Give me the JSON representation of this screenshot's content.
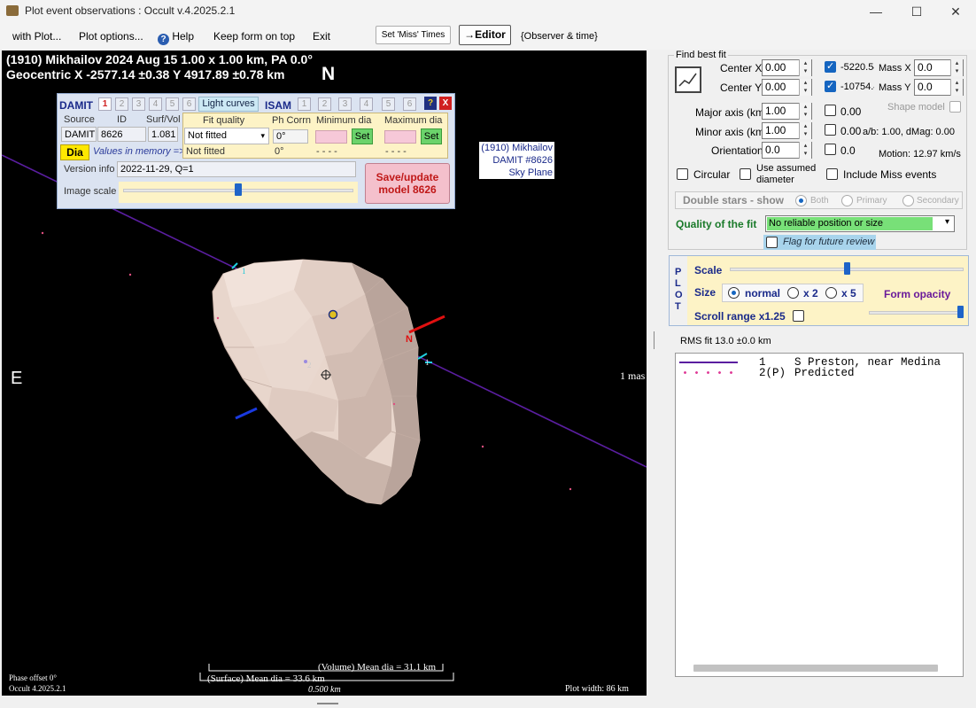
{
  "window": {
    "title": "Plot event observations : Occult v.4.2025.2.1",
    "icons": {
      "app": "app-icon",
      "minimize": "minimize-icon",
      "maximize": "maximize-icon",
      "close": "close-icon"
    }
  },
  "menu": {
    "with_plot": "with Plot...",
    "plot_options": "Plot options...",
    "help": "Help",
    "keep_on_top": "Keep form on top",
    "exit": "Exit",
    "miss_times": "Set 'Miss' Times",
    "editor": "→Editor",
    "observer_time": "{Observer & time}"
  },
  "plot": {
    "header_line1": "(1910) Mikhailov  2024 Aug 15  1.00 x 1.00 km, PA 0.0°",
    "header_line2": "Geocentric  X  -2577.14 ±0.38  Y 4917.89 ±0.78 km",
    "north": "N",
    "east": "E",
    "model_label": [
      "(1910) Mikhailov",
      "DAMIT #8626",
      "Sky Plane"
    ],
    "scale_mas": "1 mas",
    "volume_dia": "(Volume) Mean dia = 31.1 km",
    "surface_dia": "(Surface) Mean dia = 33.6 km",
    "scale_km": "0.500 km",
    "phase_offset": "Phase offset 0°",
    "version": "Occult 4.2025.2.1",
    "plot_width": "Plot width: 86 km",
    "chord1_label": "1",
    "chord2_label": "2",
    "pole_label": "N",
    "colors": {
      "background": "#000000",
      "chord": "#5a1ea0",
      "asteroid": "#e7d5cc"
    }
  },
  "damit": {
    "damit_label": "DAMIT",
    "damit_nums": [
      "1",
      "2",
      "3",
      "4",
      "5",
      "6"
    ],
    "light_curves": "Light curves",
    "isam_label": "ISAM",
    "isam_nums": [
      "1",
      "2",
      "3",
      "4",
      "5",
      "6"
    ],
    "help": "?",
    "close": "X",
    "source_hdr": "Source",
    "id_hdr": "ID",
    "surfvol_hdr": "Surf/Vol",
    "fit_hdr": "Fit quality",
    "phcorr_hdr": "Ph Corrn",
    "mindia_hdr": "Minimum dia",
    "maxdia_hdr": "Maximum dia",
    "source": "DAMIT",
    "id": "8626",
    "surfvol": "1.081",
    "fit_value": "Not fitted",
    "phcorr": "0°",
    "set": "Set",
    "dia": "Dia",
    "values_in_memory": "Values in memory =>",
    "mem_fit": "Not fitted",
    "mem_phcorr": "0°",
    "mem_min": "- - - -",
    "mem_max": "- - - -",
    "version_label": "Version info",
    "version_value": "2022-11-29, Q=1",
    "image_scale": "Image scale",
    "image_scale_level": 0.5,
    "save_model": "Save/update model 8626"
  },
  "fit": {
    "find_best_fit": "Find best fit",
    "center_x_label": "Center X",
    "center_x": "0.00",
    "center_y_label": "Center Y",
    "center_y": "0.00",
    "cx_value": "-5220.54",
    "cy_value": "-10754.4",
    "mass_x_label": "Mass X",
    "mass_x": "0.0",
    "mass_y_label": "Mass Y",
    "mass_y": "0.0",
    "major_label": "Major axis (km)",
    "major": "1.00",
    "major_val": "0.00",
    "minor_label": "Minor axis (km)",
    "minor": "1.00",
    "minor_val": "0.00",
    "orient_label": "Orientation",
    "orient": "0.0",
    "orient_val": "0.0",
    "shape_model": "Shape model",
    "ab_dmag": "a/b: 1.00, dMag: 0.00",
    "motion": "Motion: 12.97 km/s",
    "circular": "Circular",
    "use_assumed": "Use assumed diameter",
    "include_miss": "Include Miss events",
    "double_stars": "Double stars - show",
    "both": "Both",
    "primary": "Primary",
    "secondary": "Secondary",
    "quality_label": "Quality of the fit",
    "quality_value": "No reliable position or size",
    "flag_review": "Flag for future review"
  },
  "plotpanel": {
    "plot_vertical": [
      "P",
      "L",
      "O",
      "T"
    ],
    "scale_label": "Scale",
    "scale_level": 0.5,
    "size_label": "Size",
    "normal": "normal",
    "x2": "x 2",
    "x5": "x 5",
    "form_opacity": "Form opacity",
    "opacity_level": 1.0,
    "scroll_range": "Scroll range x1.25"
  },
  "rms": "RMS fit 13.0 ±0.0 km",
  "legend": {
    "rows": [
      {
        "num": "1",
        "name": "S Preston, near Medina"
      },
      {
        "num": "2(P)",
        "name": "Predicted"
      }
    ]
  }
}
